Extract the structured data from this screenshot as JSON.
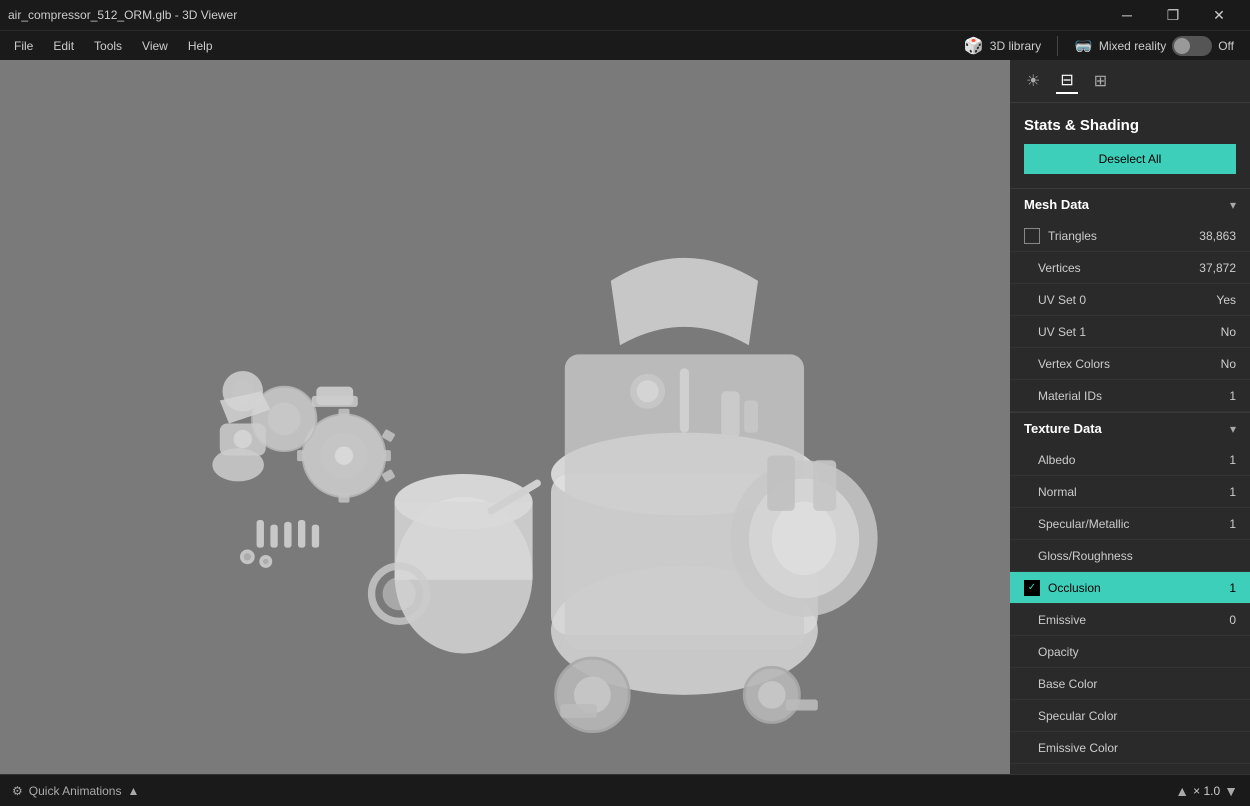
{
  "titleBar": {
    "title": "air_compressor_512_ORM.glb - 3D Viewer",
    "minimizeIcon": "─",
    "restoreIcon": "❐",
    "closeIcon": "✕"
  },
  "menuBar": {
    "items": [
      "File",
      "Edit",
      "Tools",
      "View",
      "Help"
    ],
    "right": {
      "library": {
        "icon": "🎲",
        "label": "3D library"
      },
      "mixedReality": {
        "icon": "🥽",
        "label": "Mixed reality",
        "state": "Off"
      }
    }
  },
  "panelToolbar": {
    "icons": [
      "☀",
      "📅",
      "⊞"
    ]
  },
  "rightPanel": {
    "title": "Stats & Shading",
    "deselectAllLabel": "Deselect All",
    "meshData": {
      "label": "Mesh Data",
      "rows": [
        {
          "id": "triangles",
          "label": "Triangles",
          "value": "38,863",
          "hasCheckbox": true,
          "checked": false,
          "selected": false
        },
        {
          "id": "vertices",
          "label": "Vertices",
          "value": "37,872",
          "hasCheckbox": false,
          "selected": false
        },
        {
          "id": "uvset0",
          "label": "UV Set 0",
          "value": "Yes",
          "hasCheckbox": false,
          "selected": false
        },
        {
          "id": "uvset1",
          "label": "UV Set 1",
          "value": "No",
          "hasCheckbox": false,
          "selected": false
        },
        {
          "id": "vertexColors",
          "label": "Vertex Colors",
          "value": "No",
          "hasCheckbox": false,
          "selected": false
        },
        {
          "id": "materialIds",
          "label": "Material IDs",
          "value": "1",
          "hasCheckbox": false,
          "selected": false
        }
      ]
    },
    "textureData": {
      "label": "Texture Data",
      "rows": [
        {
          "id": "albedo",
          "label": "Albedo",
          "value": "1",
          "hasCheckbox": false,
          "selected": false
        },
        {
          "id": "normal",
          "label": "Normal",
          "value": "1",
          "hasCheckbox": false,
          "selected": false
        },
        {
          "id": "specularMetallic",
          "label": "Specular/Metallic",
          "value": "1",
          "hasCheckbox": false,
          "selected": false
        },
        {
          "id": "glossRoughness",
          "label": "Gloss/Roughness",
          "value": "",
          "hasCheckbox": false,
          "selected": false
        },
        {
          "id": "occlusion",
          "label": "Occlusion",
          "value": "1",
          "hasCheckbox": true,
          "checked": true,
          "selected": true
        },
        {
          "id": "emissive",
          "label": "Emissive",
          "value": "0",
          "hasCheckbox": false,
          "selected": false
        },
        {
          "id": "opacity",
          "label": "Opacity",
          "value": "",
          "hasCheckbox": false,
          "selected": false
        },
        {
          "id": "baseColor",
          "label": "Base Color",
          "value": "",
          "hasCheckbox": false,
          "selected": false
        },
        {
          "id": "specularColor",
          "label": "Specular Color",
          "value": "",
          "hasCheckbox": false,
          "selected": false
        },
        {
          "id": "emissiveColor",
          "label": "Emissive Color",
          "value": "",
          "hasCheckbox": false,
          "selected": false
        }
      ]
    }
  },
  "bottomBar": {
    "quickAnimations": "Quick Animations",
    "zoomValue": "× 1.0"
  }
}
